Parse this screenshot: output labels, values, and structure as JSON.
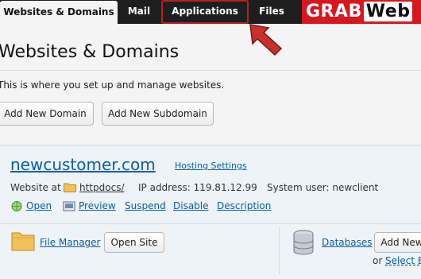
{
  "tabs": [
    {
      "label": "Websites & Domains"
    },
    {
      "label": "Mail"
    },
    {
      "label": "Applications"
    },
    {
      "label": "Files"
    }
  ],
  "logo": {
    "grab": "GRAB",
    "web": "Web"
  },
  "page": {
    "title": "Websites & Domains",
    "description": "This is where you set up and manage websites.",
    "add_domain": "Add New Domain",
    "add_subdomain": "Add New Subdomain"
  },
  "domain": {
    "name": "newcustomer.com",
    "hosting_settings": "Hosting Settings",
    "website_at_label": "Website at",
    "website_folder": "httpdocs/",
    "ip_label": "IP address: 119.81.12.99",
    "system_user_label": "System user: newclient",
    "actions": {
      "open": "Open",
      "preview": "Preview",
      "suspend": "Suspend",
      "disable": "Disable",
      "description": "Description"
    },
    "file_manager": "File Manager",
    "open_site": "Open Site",
    "databases": "Databases",
    "add_new": "Add New",
    "or_label": "or",
    "select_existing": "Select E"
  },
  "colors": {
    "accent": "#0b5fa5",
    "highlight": "#b81f1f",
    "logo_red": "#d8161f"
  }
}
